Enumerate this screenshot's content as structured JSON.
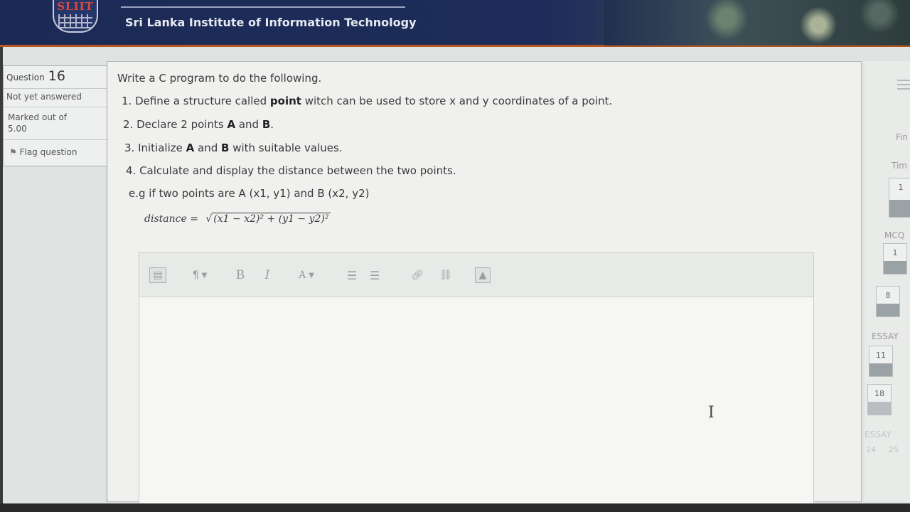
{
  "header": {
    "logo_text": "SLIIT",
    "institute_name": "Sri Lanka Institute of Information Technology"
  },
  "question_info": {
    "label": "Question",
    "number": "16",
    "status": "Not yet answered",
    "marked_label": "Marked out of",
    "marks": "5.00",
    "flag_label": "Flag question"
  },
  "question": {
    "intro": "Write a C program to do the following.",
    "step1_pre": "1. Define a structure called ",
    "step1_bold": "point",
    "step1_post": " witch can be used to store x and y coordinates of a point.",
    "step2_pre": "2. Declare 2 points ",
    "step2_a": "A",
    "step2_mid": " and ",
    "step2_b": "B",
    "step2_end": ".",
    "step3_pre": "3. Initialize ",
    "step3_a": "A",
    "step3_mid": " and ",
    "step3_b": "B",
    "step3_post": " with suitable values.",
    "step4": "4. Calculate and display the distance between the two points.",
    "example": "e.g if two points are A (x1, y1) and B (x2, y2)",
    "formula_lhs": "distance =",
    "formula_radicand": "(x1 − x2)² + (y1 − y2)²"
  },
  "editor": {
    "toolbar": {
      "bold": "B",
      "italic": "I",
      "font_color": "A"
    },
    "content": ""
  },
  "right_nav": {
    "finish_label": "Fin",
    "time_label": "Tim",
    "mcq_label": "MCQ",
    "essay_label": "ESSAY",
    "essay2_label": "ESSAY",
    "buttons": [
      "1",
      "8",
      "11",
      "18",
      "24",
      "25"
    ],
    "timer_value": "1"
  }
}
